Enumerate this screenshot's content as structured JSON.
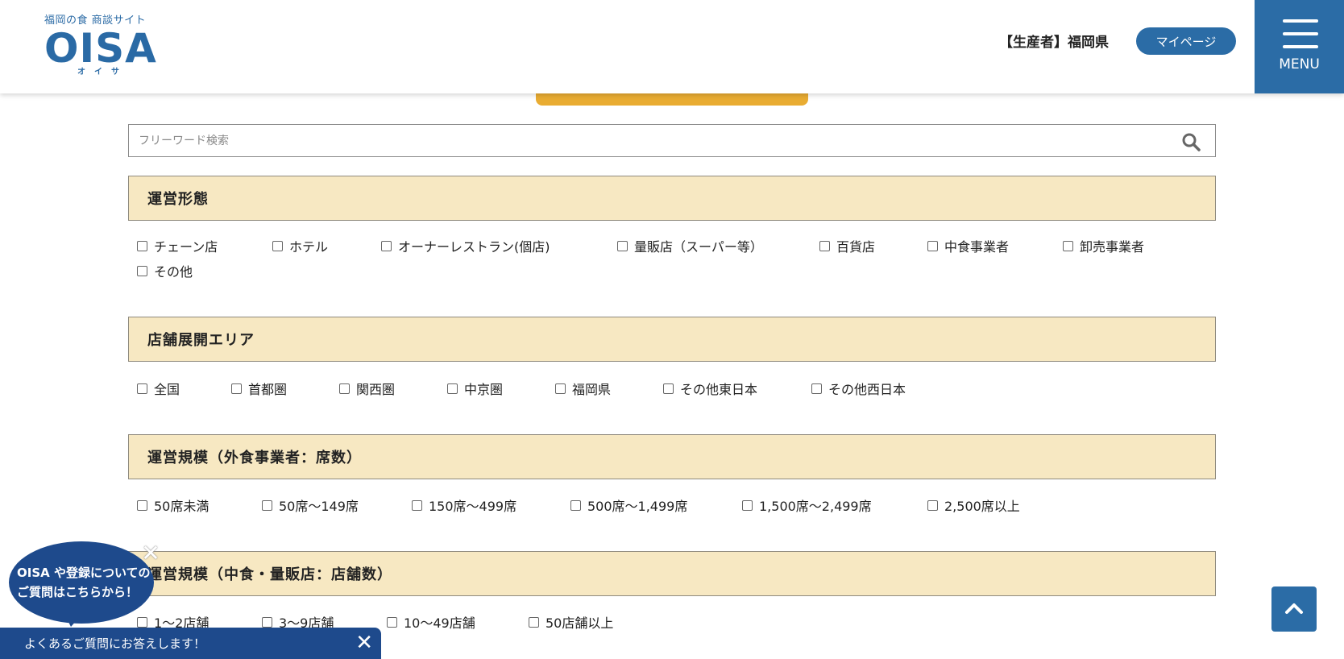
{
  "header": {
    "logo_sub": "福岡の食 商談サイト",
    "logo_main": "OISA",
    "logo_kana": "オイサ",
    "producer": "【生産者】福岡県",
    "mypage": "マイページ",
    "menu": "MENU"
  },
  "search": {
    "placeholder": "フリーワード検索"
  },
  "sections": [
    {
      "title": "運営形態",
      "options": [
        "チェーン店",
        "ホテル",
        "オーナーレストラン(個店)",
        "量販店（スーパー等）",
        "百貨店",
        "中食事業者",
        "卸売事業者",
        "その他"
      ]
    },
    {
      "title": "店舗展開エリア",
      "options": [
        "全国",
        "首都圏",
        "関西圏",
        "中京圏",
        "福岡県",
        "その他東日本",
        "その他西日本"
      ]
    },
    {
      "title": "運営規模（外食事業者：席数）",
      "options": [
        "50席未満",
        "50席〜149席",
        "150席〜499席",
        "500席〜1,499席",
        "1,500席〜2,499席",
        "2,500席以上"
      ]
    },
    {
      "title": "運営規模（中食・量販店：店舗数）",
      "options": [
        "1〜2店舗",
        "3〜9店舗",
        "10〜49店舗",
        "50店舗以上"
      ]
    }
  ],
  "help": {
    "bubble_line1": "OISA や登録についての",
    "bubble_line2": "ご質問はこちらから！",
    "faq_bar": "よくあるご質問にお答えします！"
  }
}
